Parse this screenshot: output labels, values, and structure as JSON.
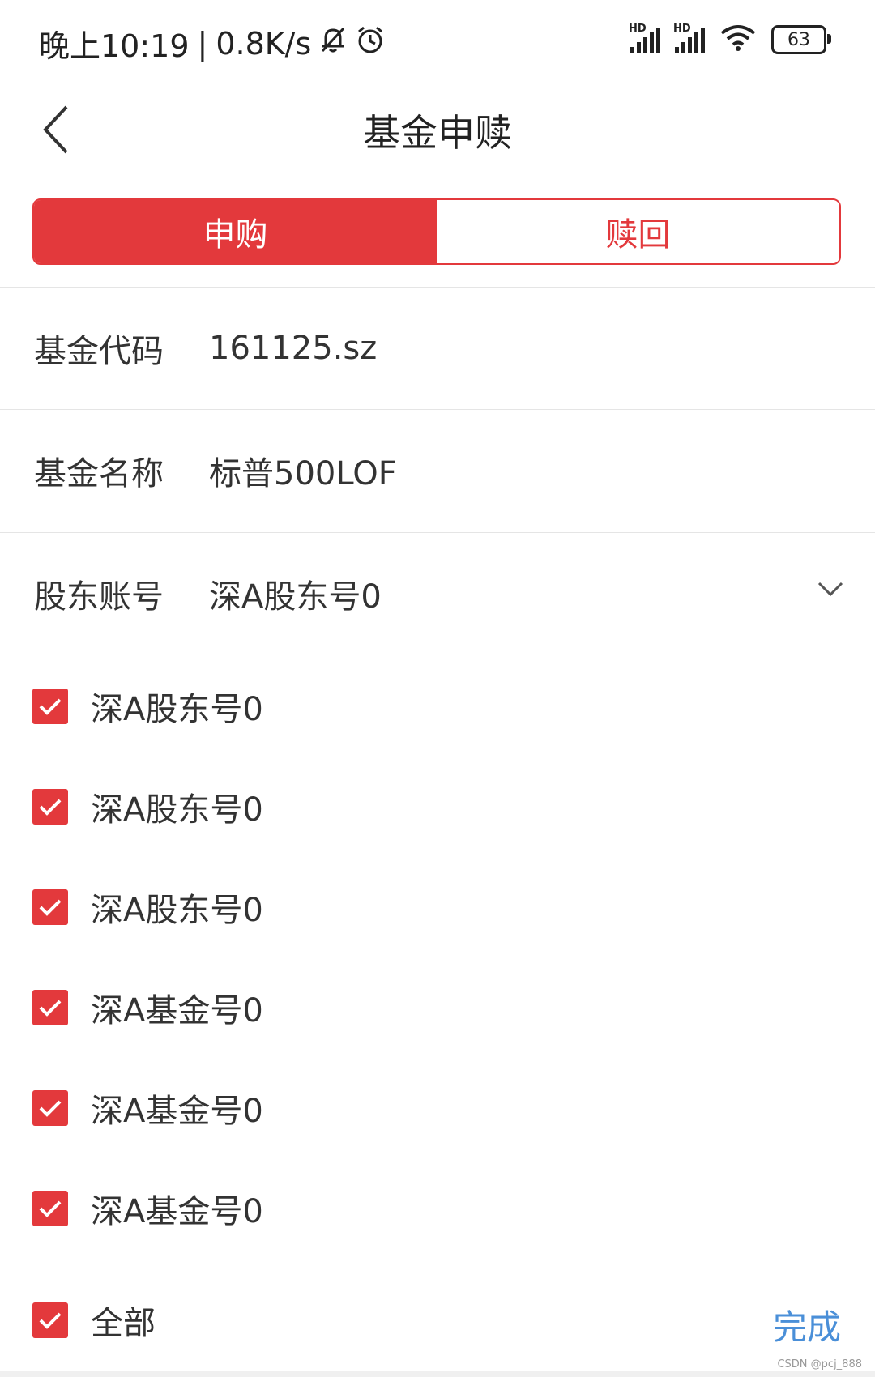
{
  "status_bar": {
    "time": "晚上10:19",
    "network_speed": "0.8K/s",
    "signal_label_1": "HD",
    "signal_label_2": "HD",
    "battery": "63",
    "icons": [
      "mute-bell-icon",
      "alarm-icon",
      "signal-icon",
      "signal-icon",
      "wifi-icon",
      "battery-icon"
    ]
  },
  "header": {
    "title": "基金申赎",
    "back_icon": "chevron-left-icon"
  },
  "tabs": [
    {
      "label": "申购",
      "active": true
    },
    {
      "label": "赎回",
      "active": false
    }
  ],
  "form": {
    "fund_code_label": "基金代码",
    "fund_code_value": "161125.sz",
    "fund_name_label": "基金名称",
    "fund_name_value": "标普500LOF",
    "account_label": "股东账号",
    "account_value": "深A股东号0",
    "dropdown_icon": "chevron-down-icon"
  },
  "accounts": [
    {
      "label": "深A股东号0",
      "checked": true
    },
    {
      "label": "深A股东号0",
      "checked": true
    },
    {
      "label": "深A股东号0",
      "checked": true
    },
    {
      "label": "深A基金号0",
      "checked": true
    },
    {
      "label": "深A基金号0",
      "checked": true
    },
    {
      "label": "深A基金号0",
      "checked": true
    }
  ],
  "footer": {
    "select_all_label": "全部",
    "select_all_checked": true,
    "done_label": "完成",
    "watermark": "CSDN @pcj_888"
  },
  "colors": {
    "accent": "#e3393c",
    "link": "#4a8fd8",
    "text": "#333333",
    "divider": "#e5e5e5"
  }
}
